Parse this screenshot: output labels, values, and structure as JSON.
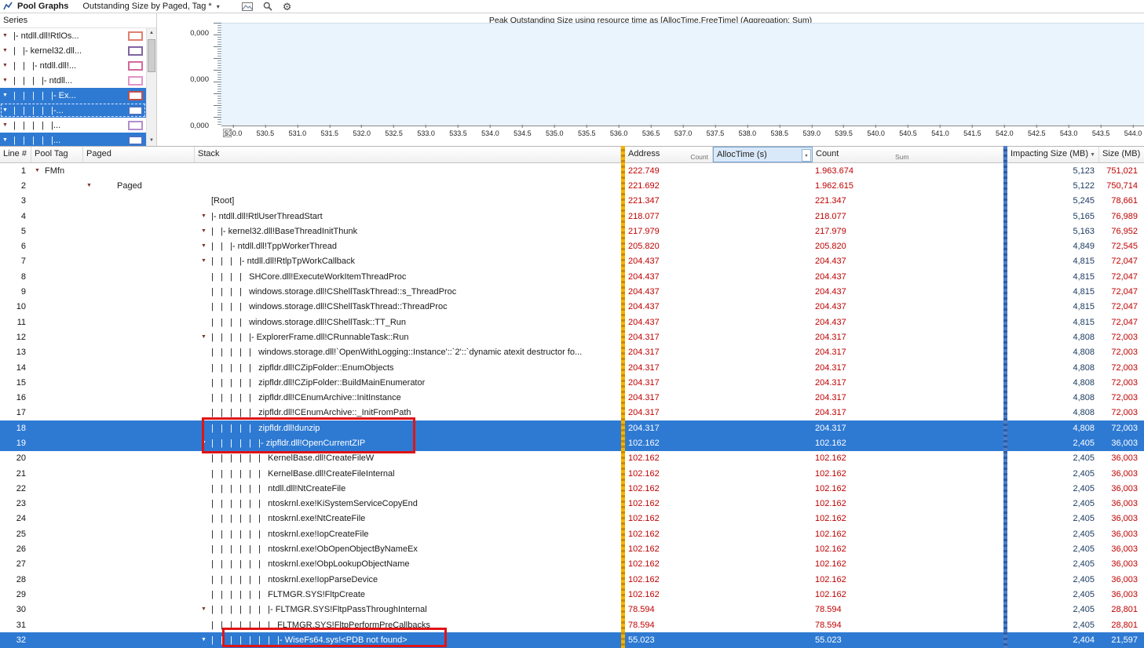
{
  "toolbar": {
    "panel_title": "Pool Graphs",
    "view_title": "Outstanding Size by Paged, Tag *"
  },
  "icons": {
    "expander": "▼",
    "caret": "▾",
    "sort": "▼",
    "scroll_up": "▲",
    "scroll_down": "▼",
    "gear": "⚙"
  },
  "colors": {
    "selection": "#2E7AD3",
    "value_red": "#C00000",
    "value_navy": "#17375E",
    "gold_bar": "#F0A500",
    "blue_bar": "#3E6CB8",
    "annotation": "#E01414",
    "plot_background": "#EAF4FD"
  },
  "series": {
    "header": "Series",
    "items": [
      {
        "label": "|- ntdll.dll!RtlOs...",
        "color": "#E08070",
        "selected": false,
        "focused": false
      },
      {
        "label": "|   |- kernel32.dll...",
        "color": "#8064A2",
        "selected": false,
        "focused": false
      },
      {
        "label": "|   |   |- ntdll.dll!...",
        "color": "#D4699E",
        "selected": false,
        "focused": false
      },
      {
        "label": "|   |   |   |- ntdll...",
        "color": "#E492C8",
        "selected": false,
        "focused": false
      },
      {
        "label": "|   |   |   |   |- Ex...",
        "color": "#C0504D",
        "selected": true,
        "focused": false
      },
      {
        "label": "|   |   |   |   |-...",
        "color": "#4472C4",
        "selected": true,
        "focused": true
      },
      {
        "label": "|   |   |   |   |...",
        "color": "#B48ECC",
        "selected": false,
        "focused": false
      },
      {
        "label": "|   |   |   |   |...",
        "color": "#4472C4",
        "selected": true,
        "focused": false
      }
    ]
  },
  "chart_data": {
    "type": "line",
    "title": "Peak Outstanding Size using resource time as [AllocTime.FreeTime] (Aggregation: Sum)",
    "x_range": [
      530.0,
      544.0
    ],
    "x_tick_step": 0.5,
    "x_ticks": [
      "530.0",
      "530.5",
      "531.0",
      "531.5",
      "532.0",
      "532.5",
      "533.0",
      "533.5",
      "534.0",
      "534.5",
      "535.0",
      "535.5",
      "536.0",
      "536.5",
      "537.0",
      "537.5",
      "538.0",
      "538.5",
      "539.0",
      "539.5",
      "540.0",
      "540.5",
      "541.0",
      "541.5",
      "542.0",
      "542.5",
      "543.0",
      "543.5",
      "544.0"
    ],
    "y_tick_labels": [
      "0,000",
      "0,000",
      "0,000"
    ],
    "series": [],
    "note": "plot area shown empty (no visible series drawn)"
  },
  "table": {
    "columns": {
      "line": "Line #",
      "pool_tag": "Pool Tag",
      "paged": "Paged",
      "stack": "Stack",
      "address": "Address",
      "address_agg": "Count",
      "alloctime": "AllocTime (s)",
      "count": "Count",
      "count_agg": "Sum",
      "impacting": "Impacting Size (MB)",
      "size": "Size (MB)"
    },
    "rows": [
      {
        "line": "1",
        "pool_exp": true,
        "pool_tag": "FMfn",
        "address": "222.749",
        "alloctime": "1.963.674",
        "count": "5,123",
        "size": "751,021"
      },
      {
        "line": "2",
        "paged_exp": true,
        "paged": "Paged",
        "address": "221.692",
        "alloctime": "1.962.615",
        "count": "5,122",
        "size": "750,714"
      },
      {
        "line": "3",
        "stack": "[Root]",
        "address": "221.347",
        "alloctime": "221.347",
        "count": "5,245",
        "size": "78,661"
      },
      {
        "line": "4",
        "exp": true,
        "stack": "|- ntdll.dll!RtlUserThreadStart",
        "address": "218.077",
        "alloctime": "218.077",
        "count": "5,165",
        "size": "76,989"
      },
      {
        "line": "5",
        "exp": true,
        "stack": "|   |- kernel32.dll!BaseThreadInitThunk",
        "address": "217.979",
        "alloctime": "217.979",
        "count": "5,163",
        "size": "76,952"
      },
      {
        "line": "6",
        "exp": true,
        "stack": "|   |   |- ntdll.dll!TppWorkerThread",
        "address": "205.820",
        "alloctime": "205.820",
        "count": "4,849",
        "size": "72,545"
      },
      {
        "line": "7",
        "exp": true,
        "stack": "|   |   |   |- ntdll.dll!RtlpTpWorkCallback",
        "address": "204.437",
        "alloctime": "204.437",
        "count": "4,815",
        "size": "72,047"
      },
      {
        "line": "8",
        "stack": "|   |   |   |   SHCore.dll!ExecuteWorkItemThreadProc",
        "address": "204.437",
        "alloctime": "204.437",
        "count": "4,815",
        "size": "72,047"
      },
      {
        "line": "9",
        "stack": "|   |   |   |   windows.storage.dll!CShellTaskThread::s_ThreadProc",
        "address": "204.437",
        "alloctime": "204.437",
        "count": "4,815",
        "size": "72,047"
      },
      {
        "line": "10",
        "stack": "|   |   |   |   windows.storage.dll!CShellTaskThread::ThreadProc",
        "address": "204.437",
        "alloctime": "204.437",
        "count": "4,815",
        "size": "72,047"
      },
      {
        "line": "11",
        "stack": "|   |   |   |   windows.storage.dll!CShellTask::TT_Run",
        "address": "204.437",
        "alloctime": "204.437",
        "count": "4,815",
        "size": "72,047"
      },
      {
        "line": "12",
        "exp": true,
        "stack": "|   |   |   |   |- ExplorerFrame.dll!CRunnableTask::Run",
        "address": "204.317",
        "alloctime": "204.317",
        "count": "4,808",
        "size": "72,003"
      },
      {
        "line": "13",
        "stack": "|   |   |   |   |   windows.storage.dll!`OpenWithLogging::Instance'::`2'::`dynamic atexit destructor fo...",
        "address": "204.317",
        "alloctime": "204.317",
        "count": "4,808",
        "size": "72,003"
      },
      {
        "line": "14",
        "stack": "|   |   |   |   |   zipfldr.dll!CZipFolder::EnumObjects",
        "address": "204.317",
        "alloctime": "204.317",
        "count": "4,808",
        "size": "72,003"
      },
      {
        "line": "15",
        "stack": "|   |   |   |   |   zipfldr.dll!CZipFolder::BuildMainEnumerator",
        "address": "204.317",
        "alloctime": "204.317",
        "count": "4,808",
        "size": "72,003"
      },
      {
        "line": "16",
        "stack": "|   |   |   |   |   zipfldr.dll!CEnumArchive::InitInstance",
        "address": "204.317",
        "alloctime": "204.317",
        "count": "4,808",
        "size": "72,003"
      },
      {
        "line": "17",
        "stack": "|   |   |   |   |   zipfldr.dll!CEnumArchive::_InitFromPath",
        "address": "204.317",
        "alloctime": "204.317",
        "count": "4,808",
        "size": "72,003"
      },
      {
        "line": "18",
        "sel": true,
        "stack": "|   |   |   |   |   zipfldr.dll!dunzip",
        "address": "204.317",
        "alloctime": "204.317",
        "count": "4,808",
        "size": "72,003"
      },
      {
        "line": "19",
        "sel": true,
        "exp": true,
        "stack": "|   |   |   |   |   |- zipfldr.dll!OpenCurrentZIP",
        "address": "102.162",
        "alloctime": "102.162",
        "count": "2,405",
        "size": "36,003"
      },
      {
        "line": "20",
        "stack": "|   |   |   |   |   |   KernelBase.dll!CreateFileW",
        "address": "102.162",
        "alloctime": "102.162",
        "count": "2,405",
        "size": "36,003"
      },
      {
        "line": "21",
        "stack": "|   |   |   |   |   |   KernelBase.dll!CreateFileInternal",
        "address": "102.162",
        "alloctime": "102.162",
        "count": "2,405",
        "size": "36,003"
      },
      {
        "line": "22",
        "stack": "|   |   |   |   |   |   ntdll.dll!NtCreateFile",
        "address": "102.162",
        "alloctime": "102.162",
        "count": "2,405",
        "size": "36,003"
      },
      {
        "line": "23",
        "stack": "|   |   |   |   |   |   ntoskrnl.exe!KiSystemServiceCopyEnd",
        "address": "102.162",
        "alloctime": "102.162",
        "count": "2,405",
        "size": "36,003"
      },
      {
        "line": "24",
        "stack": "|   |   |   |   |   |   ntoskrnl.exe!NtCreateFile",
        "address": "102.162",
        "alloctime": "102.162",
        "count": "2,405",
        "size": "36,003"
      },
      {
        "line": "25",
        "stack": "|   |   |   |   |   |   ntoskrnl.exe!IopCreateFile",
        "address": "102.162",
        "alloctime": "102.162",
        "count": "2,405",
        "size": "36,003"
      },
      {
        "line": "26",
        "stack": "|   |   |   |   |   |   ntoskrnl.exe!ObOpenObjectByNameEx",
        "address": "102.162",
        "alloctime": "102.162",
        "count": "2,405",
        "size": "36,003"
      },
      {
        "line": "27",
        "stack": "|   |   |   |   |   |   ntoskrnl.exe!ObpLookupObjectName",
        "address": "102.162",
        "alloctime": "102.162",
        "count": "2,405",
        "size": "36,003"
      },
      {
        "line": "28",
        "stack": "|   |   |   |   |   |   ntoskrnl.exe!IopParseDevice",
        "address": "102.162",
        "alloctime": "102.162",
        "count": "2,405",
        "size": "36,003"
      },
      {
        "line": "29",
        "stack": "|   |   |   |   |   |   FLTMGR.SYS!FltpCreate",
        "address": "102.162",
        "alloctime": "102.162",
        "count": "2,405",
        "size": "36,003"
      },
      {
        "line": "30",
        "exp": true,
        "stack": "|   |   |   |   |   |   |- FLTMGR.SYS!FltpPassThroughInternal",
        "address": "78.594",
        "alloctime": "78.594",
        "count": "2,405",
        "size": "28,801"
      },
      {
        "line": "31",
        "stack": "|   |   |   |   |   |   |   FLTMGR.SYS!FltpPerformPreCallbacks",
        "address": "78.594",
        "alloctime": "78.594",
        "count": "2,405",
        "size": "28,801"
      },
      {
        "line": "32",
        "sel": true,
        "exp": true,
        "stack": "|   |   |   |   |   |   |   |- WiseFs64.sys!<PDB not found>",
        "address": "55.023",
        "alloctime": "55.023",
        "count": "2,404",
        "size": "21,597"
      }
    ]
  },
  "annotations": {
    "color": "#E01414",
    "boxes": [
      {
        "target": "stack cells rows 18-19 (zipfldr.dll!dunzip / zipfldr.dll!OpenCurrentZIP)"
      },
      {
        "target": "stack cell row 32 (WiseFs64.sys!<PDB not found>)"
      }
    ]
  }
}
